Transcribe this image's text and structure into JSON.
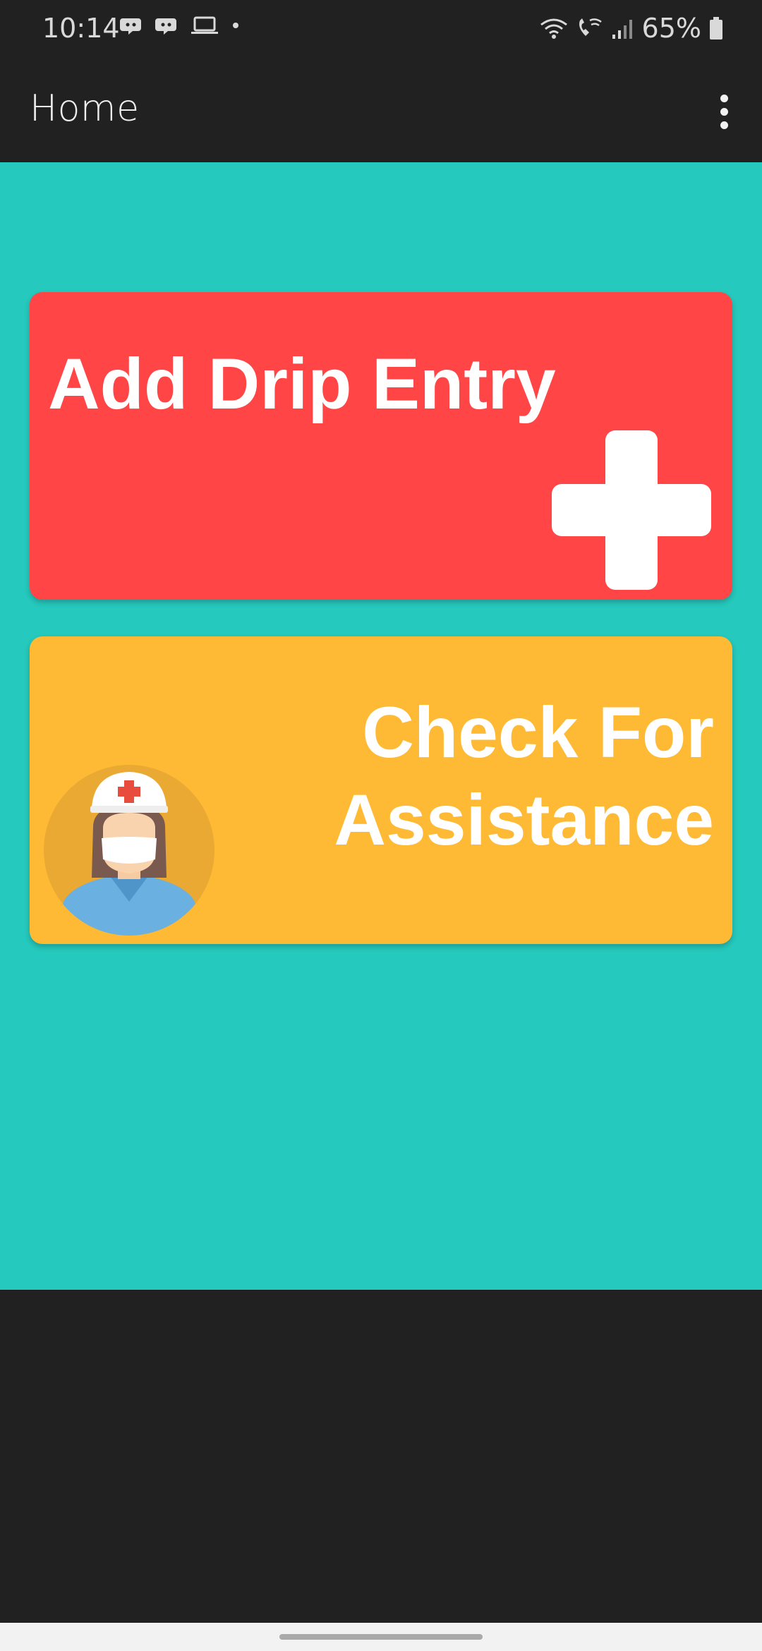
{
  "status_bar": {
    "time": "10:14",
    "battery_percent": "65%",
    "left_icons": [
      "discord-icon",
      "discord-icon",
      "laptop-icon",
      "dot-icon"
    ],
    "right_icons": [
      "wifi-icon",
      "wifi-call-icon",
      "signal-icon",
      "battery-icon"
    ]
  },
  "app_bar": {
    "title": "Home",
    "menu_icon": "more-vert-icon"
  },
  "cards": {
    "add_drip": {
      "label": "Add Drip Entry",
      "icon": "plus-icon",
      "color": "#ff4545"
    },
    "assistance": {
      "line1": "Check For",
      "line2": "Assistance",
      "icon": "nurse-icon",
      "color": "#ffba35"
    }
  },
  "colors": {
    "background": "#26c9bd",
    "app_bar": "#212121"
  }
}
